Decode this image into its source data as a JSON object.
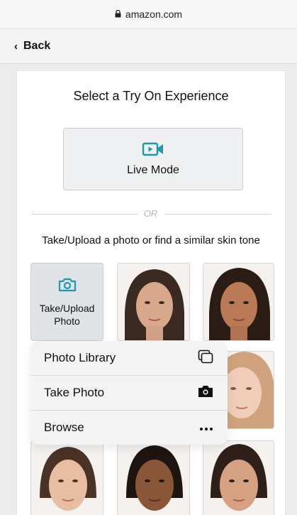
{
  "browser": {
    "url": "amazon.com"
  },
  "nav": {
    "back_label": "Back"
  },
  "page": {
    "heading": "Select a Try On Experience",
    "live_mode_label": "Live Mode",
    "divider_text": "OR",
    "subheading": "Take/Upload a photo or find a similar skin tone",
    "upload_label_line1": "Take/Upload",
    "upload_label_line2": "Photo"
  },
  "menu": {
    "items": [
      {
        "label": "Photo Library",
        "icon": "photo-library-icon"
      },
      {
        "label": "Take Photo",
        "icon": "camera-icon"
      },
      {
        "label": "Browse",
        "icon": "more-icon"
      }
    ]
  },
  "colors": {
    "accent": "#1a9bab",
    "panel": "#ffffff",
    "background": "#ececec"
  }
}
